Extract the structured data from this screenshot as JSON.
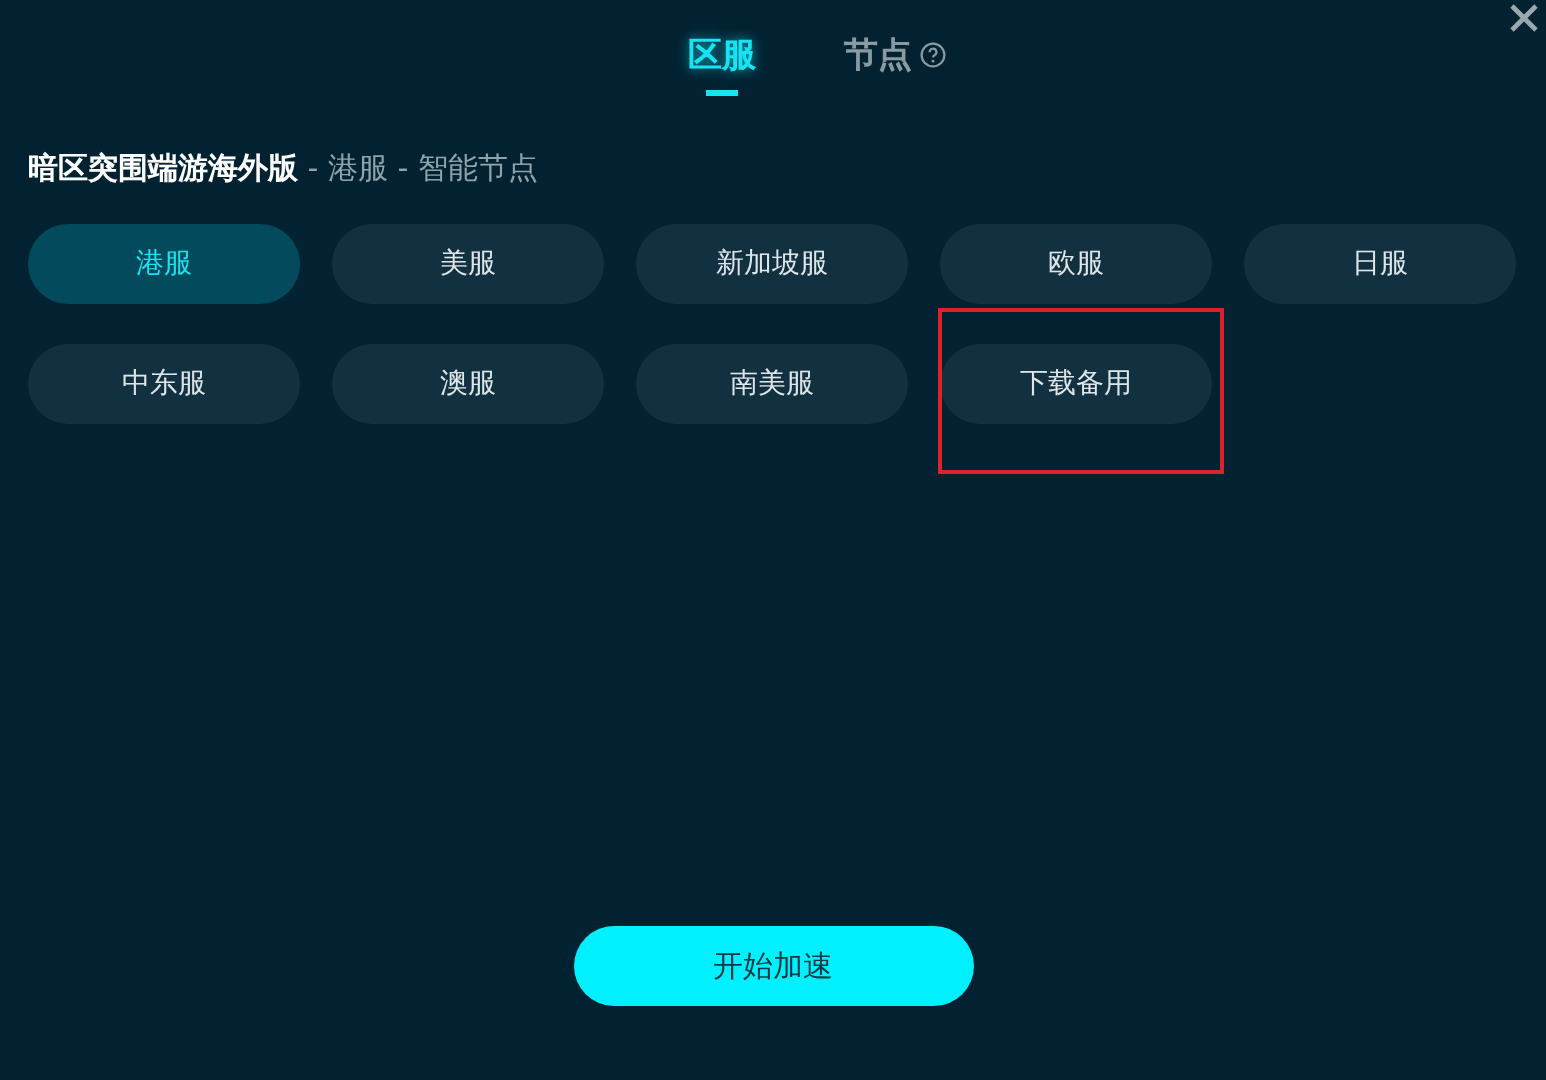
{
  "tabs": [
    {
      "label": "区服",
      "selected": true,
      "help": false
    },
    {
      "label": "节点",
      "selected": false,
      "help": true
    }
  ],
  "heading": "**暗区突围端游海外版** - 港服 - 智能节点",
  "servers": [
    {
      "label": "港服",
      "selected": true,
      "highlighted": false
    },
    {
      "label": "美服",
      "selected": false,
      "highlighted": false
    },
    {
      "label": "新加坡服",
      "selected": false,
      "highlighted": false
    },
    {
      "label": "欧服",
      "selected": false,
      "highlighted": false
    },
    {
      "label": "日服",
      "selected": false,
      "highlighted": false
    },
    {
      "label": "中东服",
      "selected": false,
      "highlighted": false
    },
    {
      "label": "澳服",
      "selected": false,
      "highlighted": false
    },
    {
      "label": "南美服",
      "selected": false,
      "highlighted": false
    },
    {
      "label": "下载备用",
      "selected": false,
      "highlighted": true
    }
  ],
  "start_button": "开始加速"
}
